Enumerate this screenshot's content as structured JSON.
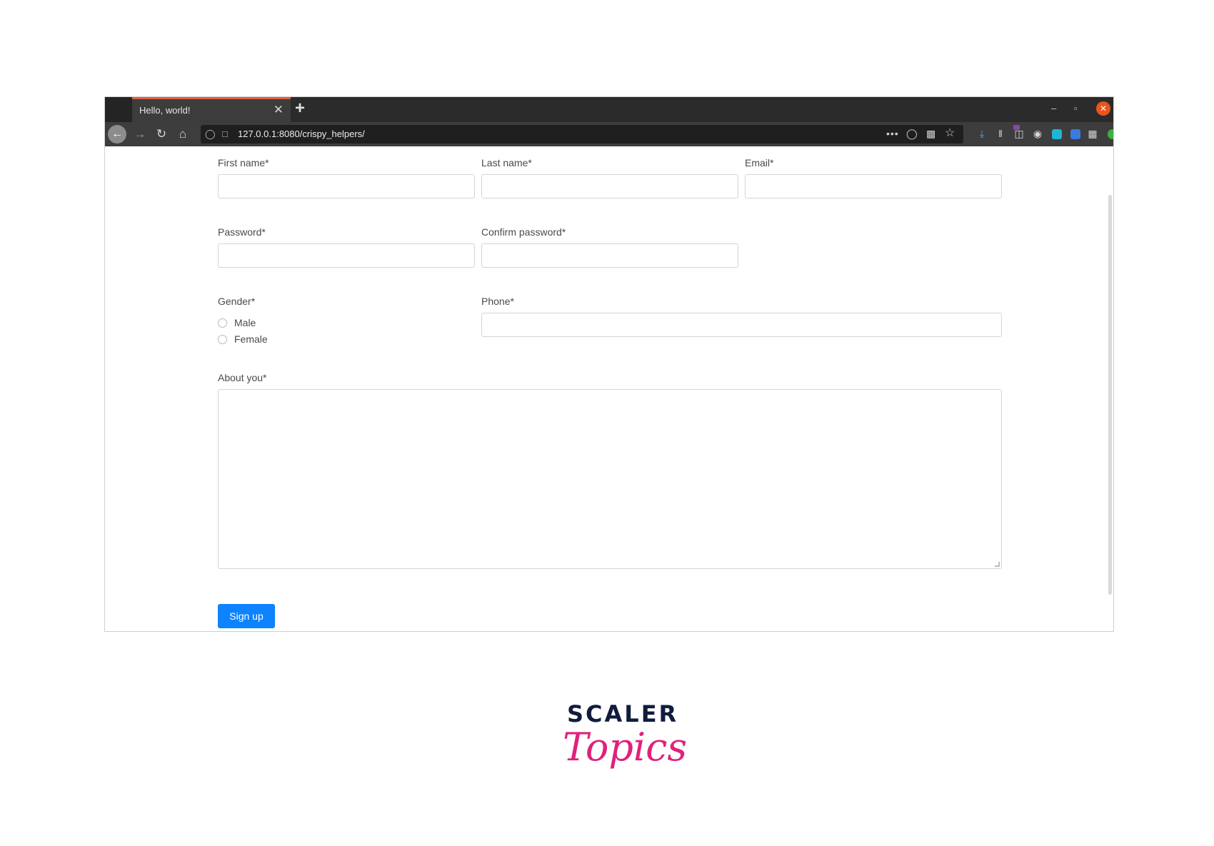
{
  "browser": {
    "tab": {
      "title": "Hello, world!",
      "close_glyph": "✕"
    },
    "new_tab_glyph": "+",
    "window_controls": {
      "minimize": "–",
      "maximize": "▫",
      "close": "✕"
    },
    "nav": {
      "back_icon": "back-arrow-icon",
      "forward_icon": "forward-arrow-icon",
      "reload_icon": "reload-icon",
      "home_icon": "home-icon"
    },
    "url": "127.0.0.1:8080/crispy_helpers/",
    "url_more_glyph": "•••",
    "toolbar_icons": [
      "downloads-icon",
      "library-icon",
      "sidebar-icon",
      "extension-icon",
      "extension-icon",
      "extension-icon",
      "extension-icon",
      "extension-icon",
      "extension-icon",
      "extension-icon",
      "menu-icon"
    ]
  },
  "form": {
    "first_name_label": "First name*",
    "last_name_label": "Last name*",
    "email_label": "Email*",
    "password_label": "Password*",
    "confirm_password_label": "Confirm password*",
    "gender_label": "Gender*",
    "gender_options": [
      "Male",
      "Female"
    ],
    "phone_label": "Phone*",
    "about_label": "About you*",
    "submit_label": "Sign up",
    "submit_color": "#0d83fd"
  },
  "logo": {
    "top_text": "SCALER",
    "bottom_text": "Topics",
    "top_color": "#111c3d",
    "bottom_color": "#e0227a"
  }
}
